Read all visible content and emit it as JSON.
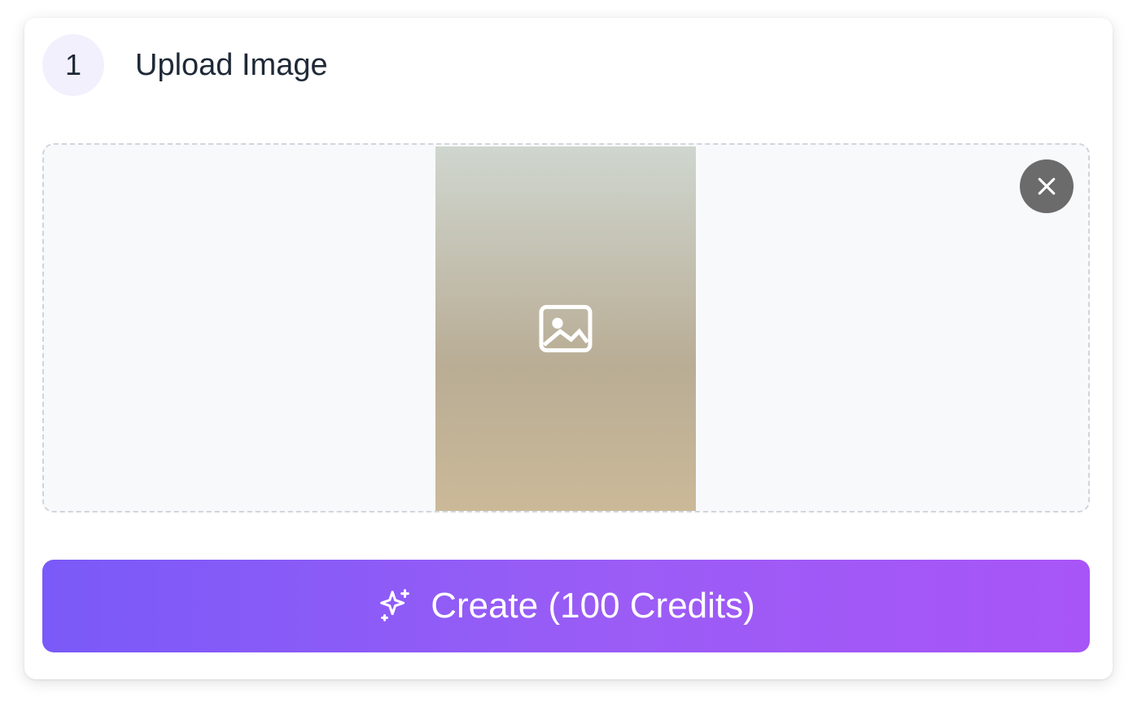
{
  "step": {
    "number": "1",
    "title": "Upload Image"
  },
  "upload": {
    "remove_icon": "close-icon"
  },
  "create_button": {
    "label": "Create (100 Credits)",
    "icon": "sparkle-icon"
  },
  "colors": {
    "accent_start": "#7a5af8",
    "accent_end": "#a855f7",
    "step_badge_bg": "#f3f0fe",
    "remove_button_bg": "#6b6b6b"
  }
}
